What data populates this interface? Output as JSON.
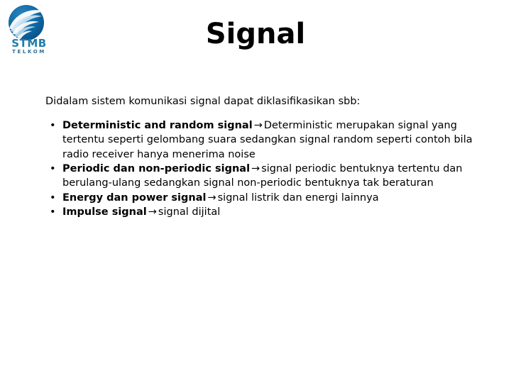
{
  "slide": {
    "title": "Signal",
    "background_color": "#ffffff",
    "text_color": "#000000"
  },
  "logo": {
    "mark_name": "stmb-telkom-swirl-mark",
    "primary_text": "STMB",
    "secondary_text": "TELKOM",
    "circle_color_dark": "#0d5c96",
    "circle_color_mid": "#1b6fa8",
    "swirl_color": "#ffffff",
    "wordmark_color": "#1e7fa8",
    "subtext_color": "#2a6f8e"
  },
  "body": {
    "intro": "Didalam sistem komunikasi signal dapat diklasifikasikan sbb:",
    "bullet_char": "•",
    "arrow_char": "→",
    "bullets": [
      {
        "lead": "Deterministic and random signal",
        "rest": "Deterministic merupakan signal yang tertentu seperti gelombang suara sedangkan signal random seperti contoh bila radio receiver hanya menerima noise"
      },
      {
        "lead": "Periodic dan non-periodic signal",
        "rest": "signal periodic bentuknya tertentu dan berulang-ulang sedangkan signal non-periodic bentuknya tak beraturan"
      },
      {
        "lead": "Energy dan power signal",
        "rest": "signal listrik dan energi lainnya"
      },
      {
        "lead": "Impulse signal",
        "rest": "signal dijital"
      }
    ]
  }
}
